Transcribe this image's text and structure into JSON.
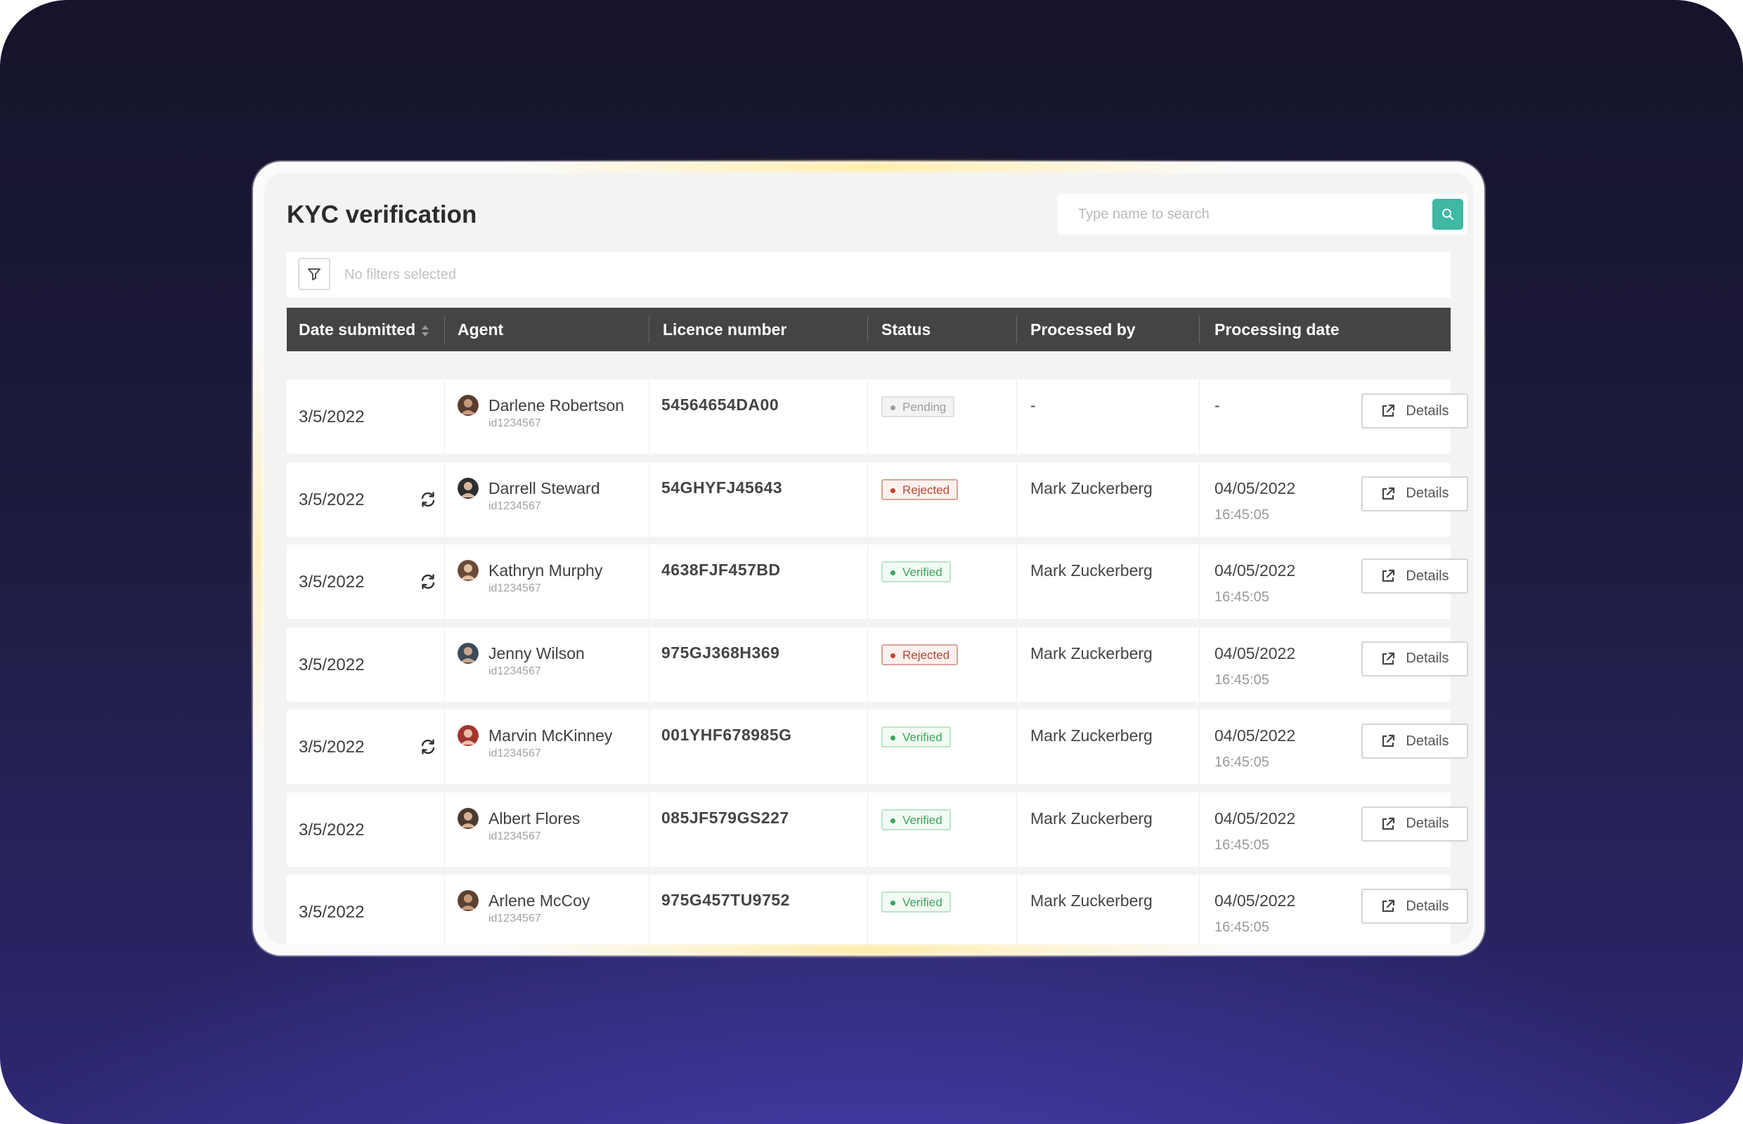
{
  "header": {
    "title": "KYC verification"
  },
  "search": {
    "placeholder": "Type name to search",
    "icon": "search-icon",
    "accent": "#3fb8a4"
  },
  "filters": {
    "text": "No filters selected",
    "icon": "filter-icon"
  },
  "table": {
    "columns": [
      "Date submitted",
      "Agent",
      "Licence number",
      "Status",
      "Processed by",
      "Processing date"
    ],
    "details_label": "Details",
    "rows": [
      {
        "date": "3/5/2022",
        "sync": false,
        "agent": "Darlene Robertson",
        "agent_id": "id1234567",
        "licence": "54564654DA00",
        "status": "Pending",
        "status_kind": "pending",
        "processed_by": "-",
        "processing_date": "-",
        "processing_time": ""
      },
      {
        "date": "3/5/2022",
        "sync": true,
        "agent": "Darrell Steward",
        "agent_id": "id1234567",
        "licence": "54GHYFJ45643",
        "status": "Rejected",
        "status_kind": "rejected",
        "processed_by": "Mark Zuckerberg",
        "processing_date": "04/05/2022",
        "processing_time": "16:45:05"
      },
      {
        "date": "3/5/2022",
        "sync": true,
        "agent": "Kathryn Murphy",
        "agent_id": "id1234567",
        "licence": "4638FJF457BD",
        "status": "Verified",
        "status_kind": "verified",
        "processed_by": "Mark Zuckerberg",
        "processing_date": "04/05/2022",
        "processing_time": "16:45:05"
      },
      {
        "date": "3/5/2022",
        "sync": false,
        "agent": "Jenny Wilson",
        "agent_id": "id1234567",
        "licence": "975GJ368H369",
        "status": "Rejected",
        "status_kind": "rejected",
        "processed_by": "Mark Zuckerberg",
        "processing_date": "04/05/2022",
        "processing_time": "16:45:05"
      },
      {
        "date": "3/5/2022",
        "sync": true,
        "agent": "Marvin McKinney",
        "agent_id": "id1234567",
        "licence": "001YHF678985G",
        "status": "Verified",
        "status_kind": "verified",
        "processed_by": "Mark Zuckerberg",
        "processing_date": "04/05/2022",
        "processing_time": "16:45:05"
      },
      {
        "date": "3/5/2022",
        "sync": false,
        "agent": "Albert Flores",
        "agent_id": "id1234567",
        "licence": "085JF579GS227",
        "status": "Verified",
        "status_kind": "verified",
        "processed_by": "Mark Zuckerberg",
        "processing_date": "04/05/2022",
        "processing_time": "16:45:05"
      },
      {
        "date": "3/5/2022",
        "sync": false,
        "agent": "Arlene McCoy",
        "agent_id": "id1234567",
        "licence": "975G457TU9752",
        "status": "Verified",
        "status_kind": "verified",
        "processed_by": "Mark Zuckerberg",
        "processing_date": "04/05/2022",
        "processing_time": "16:45:05"
      }
    ]
  },
  "colors": {
    "header_bg": "#444444",
    "pending": "#9d9d9d",
    "rejected": "#c2432a",
    "verified": "#3da45c"
  }
}
